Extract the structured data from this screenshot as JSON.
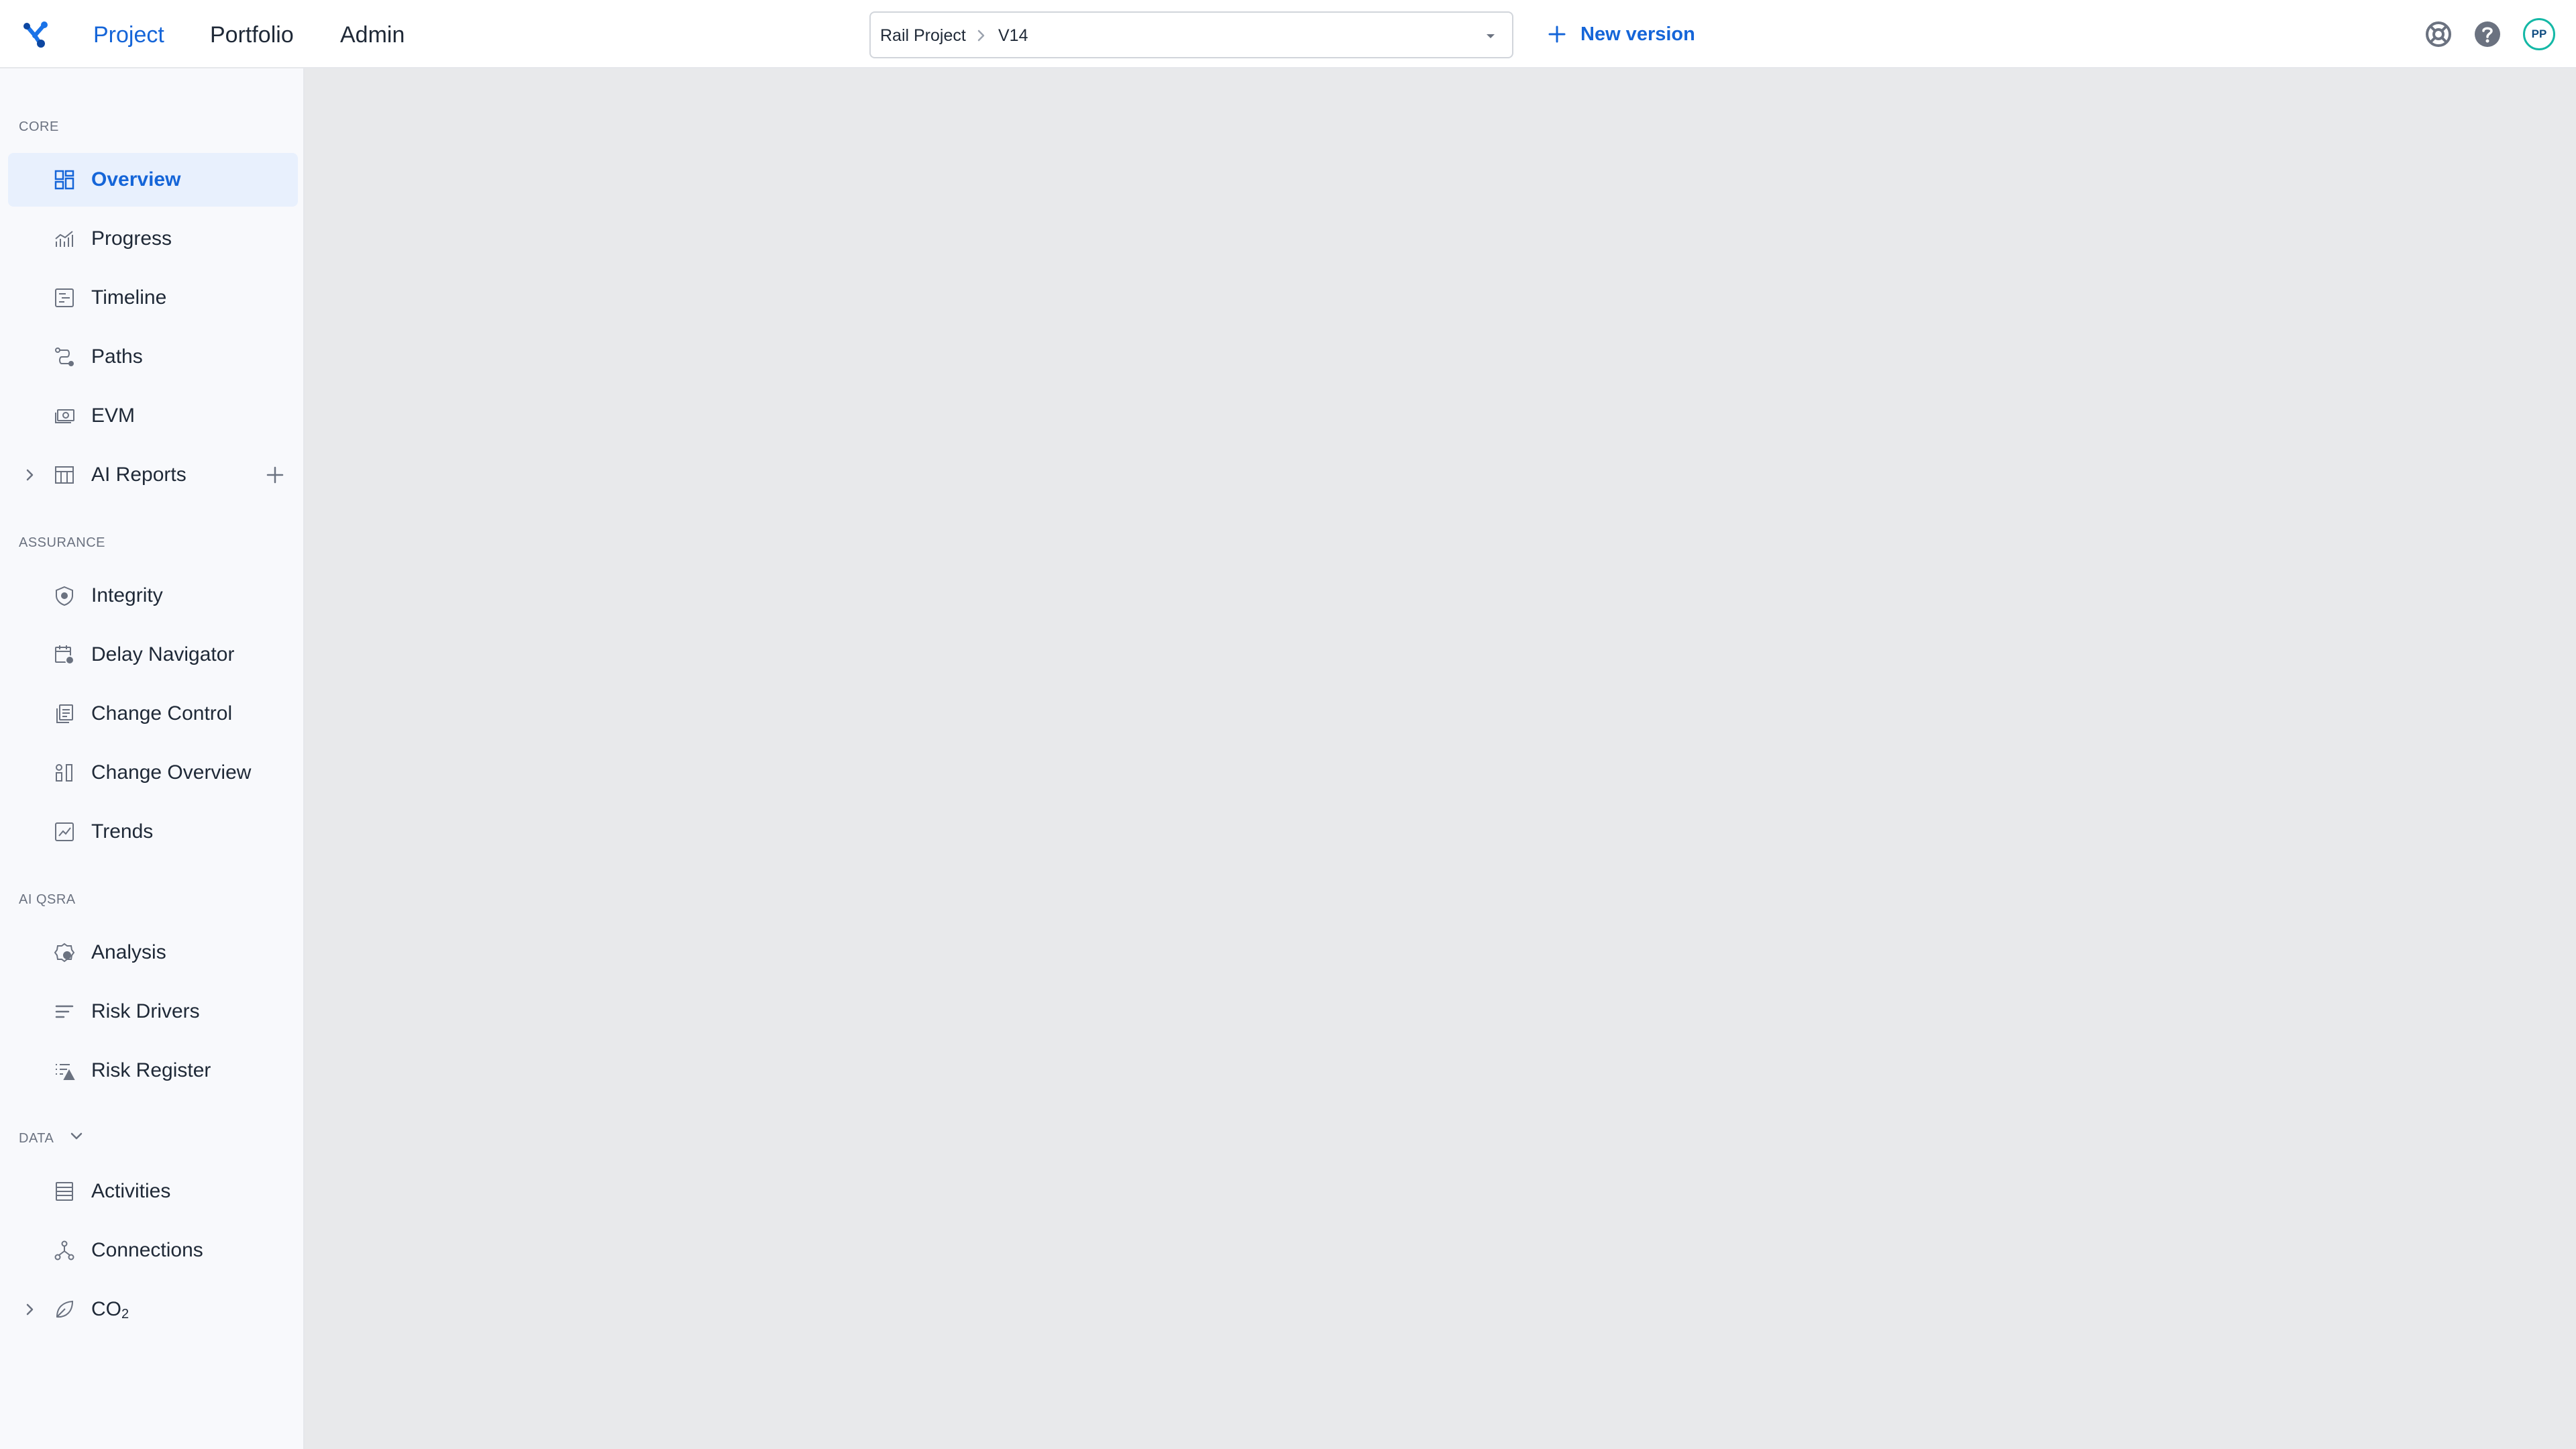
{
  "topbar": {
    "nav": [
      "Project",
      "Portfolio",
      "Admin"
    ],
    "active_nav": "Project",
    "version_selector": {
      "project": "Rail Project",
      "version": "V14"
    },
    "new_version_label": "New version",
    "avatar_initials": "PP"
  },
  "sidebar": {
    "sections": {
      "core": "CORE",
      "assurance": "ASSURANCE",
      "ai_qsra": "AI QSRA",
      "data": "DATA"
    },
    "items": {
      "overview": "Overview",
      "progress": "Progress",
      "timeline": "Timeline",
      "paths": "Paths",
      "evm": "EVM",
      "ai_reports": "AI Reports",
      "integrity": "Integrity",
      "delay_navigator": "Delay Navigator",
      "change_control": "Change Control",
      "change_overview": "Change Overview",
      "trends": "Trends",
      "analysis": "Analysis",
      "risk_drivers": "Risk Drivers",
      "risk_register": "Risk Register",
      "activities": "Activities",
      "connections": "Connections",
      "co2_base": "CO",
      "co2_sub": "2"
    },
    "active_item": "Overview"
  },
  "colors": {
    "accent": "#1565d8",
    "active_bg": "#e8f0fd",
    "sidebar_bg": "#f8f9fc",
    "main_bg": "#e8e9eb",
    "avatar_ring": "#14b8a6"
  }
}
